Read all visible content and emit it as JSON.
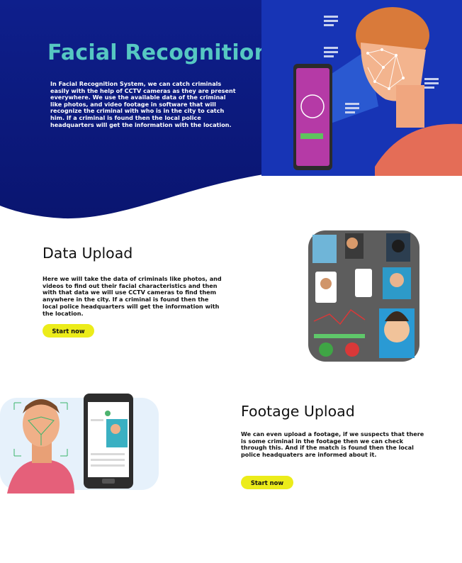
{
  "hero": {
    "title": "Facial Recognition",
    "description": "In Facial Recognition System, we can catch criminals easily with the help of CCTV cameras as they are present everywhere.  We use the available data of the criminal like photos, and video footage in software that will recognize the criminal with who is in the city to catch him. If a criminal is found then the local police headquarters will get the information with the location."
  },
  "data_upload": {
    "title": "Data Upload",
    "description": "Here we will take the data of criminals like photos, and videos to find out their facial characteristics and then with that data we will use CCTV cameras to find them anywhere in the city. If a criminal is found then the local police headquarters will get the information with the location.",
    "button_label": "Start now"
  },
  "footage_upload": {
    "title": "Footage Upload",
    "description": "We can even upload a footage, if we suspects that there is some criminal in the footage  then we can check through this. And if the match is found then the local police headquaters are informed about it.",
    "button_label": "Start now"
  },
  "colors": {
    "hero_dark": "#0b1a7a",
    "hero_light": "#1734b5",
    "title_teal": "#56c8c2",
    "button_yellow": "#ecec1a"
  }
}
